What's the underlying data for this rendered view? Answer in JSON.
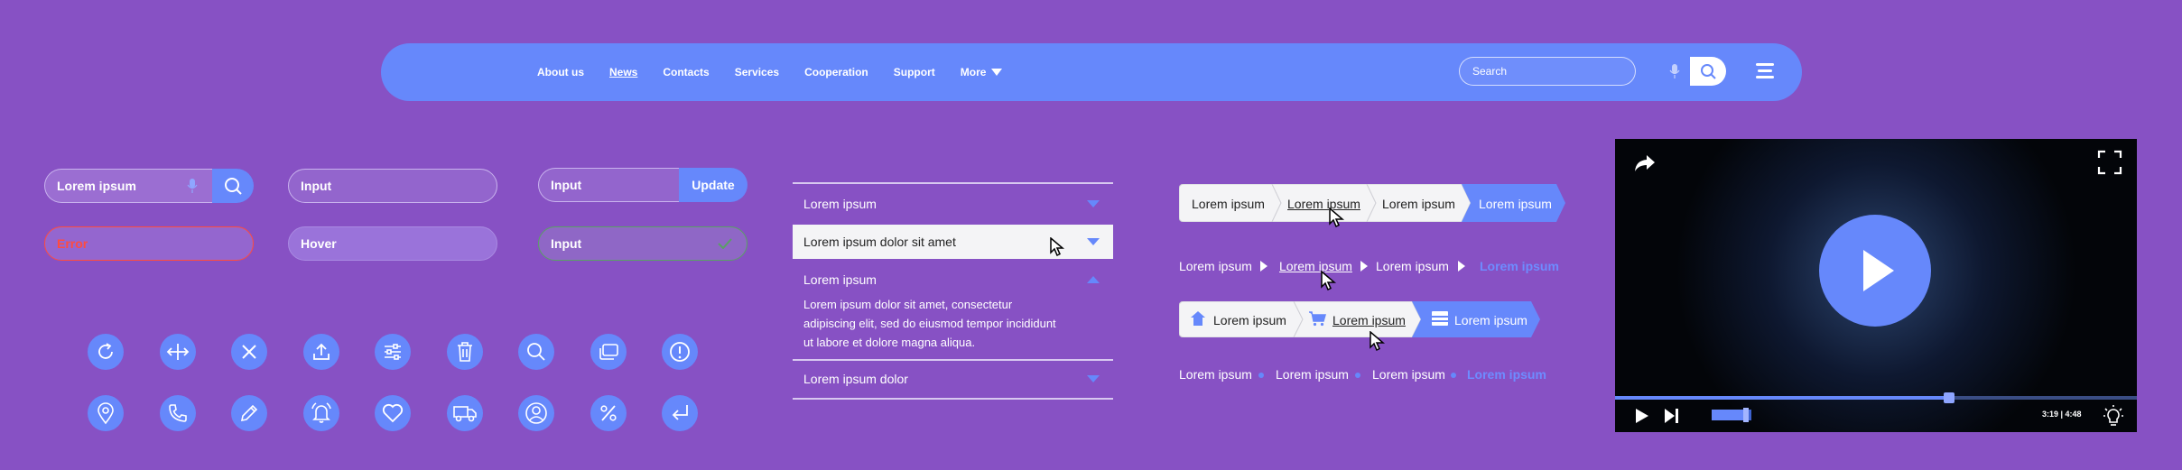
{
  "nav": {
    "links": [
      "About us",
      "News",
      "Contacts",
      "Services",
      "Cooperation",
      "Support"
    ],
    "more_label": "More",
    "search_placeholder": "Search"
  },
  "inputs": {
    "search_value": "Lorem ipsum",
    "input_label": "Input",
    "hover_label": "Hover",
    "error_label": "Error",
    "update_label": "Update",
    "success_label": "Input"
  },
  "icons": {
    "row1": [
      "refresh-icon",
      "resize-horizontal-icon",
      "close-icon",
      "upload-icon",
      "sliders-icon",
      "trash-icon",
      "search-icon",
      "windows-icon",
      "alert-icon"
    ],
    "row2": [
      "location-pin-icon",
      "phone-icon",
      "pencil-icon",
      "bell-icon",
      "heart-icon",
      "truck-icon",
      "user-icon",
      "percent-icon",
      "enter-icon"
    ]
  },
  "accordion": {
    "item1": "Lorem ipsum",
    "item2": "Lorem ipsum dolor sit amet",
    "item3": "Lorem ipsum",
    "item3_body_line1": "Lorem ipsum dolor sit amet, consectetur",
    "item3_body_line2": "adipiscing elit, sed do eiusmod tempor incididunt",
    "item3_body_line3": "ut labore et dolore magna aliqua.",
    "item4": "Lorem ipsum dolor"
  },
  "breadcrumbs": {
    "item": "Lorem ipsum"
  },
  "video": {
    "time": "3:19 | 4:48",
    "progress_fraction": 0.64,
    "volume_fraction": 0.86
  },
  "colors": {
    "background": "#8751c4",
    "accent": "#6688fb",
    "error": "#ff4b40",
    "success": "#5aa065"
  }
}
